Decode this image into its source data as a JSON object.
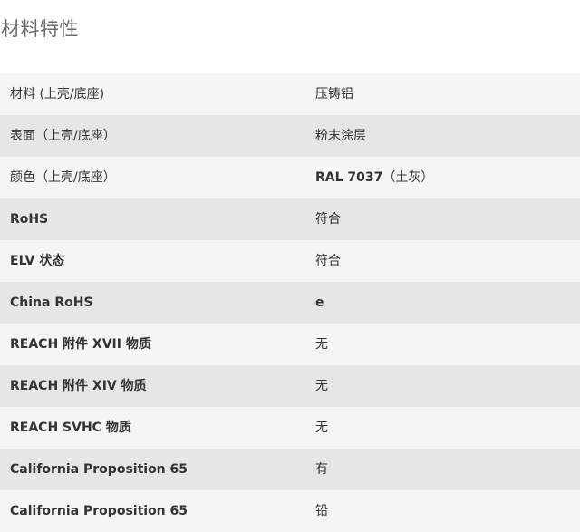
{
  "section": {
    "title": "材料特性"
  },
  "rows": [
    {
      "label": "材料 (上壳/底座)",
      "value": "压铸铝"
    },
    {
      "label": "表面（上壳/底座）",
      "value": "粉末涂层"
    },
    {
      "label": "颜色（上壳/底座）",
      "value_strong": "RAL 7037",
      "value": "（土灰）"
    },
    {
      "label": "RoHS",
      "value": "符合"
    },
    {
      "label": "ELV 状态",
      "value": "符合"
    },
    {
      "label": "China RoHS",
      "value": "e"
    },
    {
      "label": "REACH 附件 XVII 物质",
      "value": "无"
    },
    {
      "label": "REACH 附件 XIV 物质",
      "value": "无"
    },
    {
      "label": "REACH SVHC 物质",
      "value": "无"
    },
    {
      "label": "California Proposition 65",
      "value": "有"
    },
    {
      "label": "California Proposition 65",
      "value": "铅"
    }
  ]
}
